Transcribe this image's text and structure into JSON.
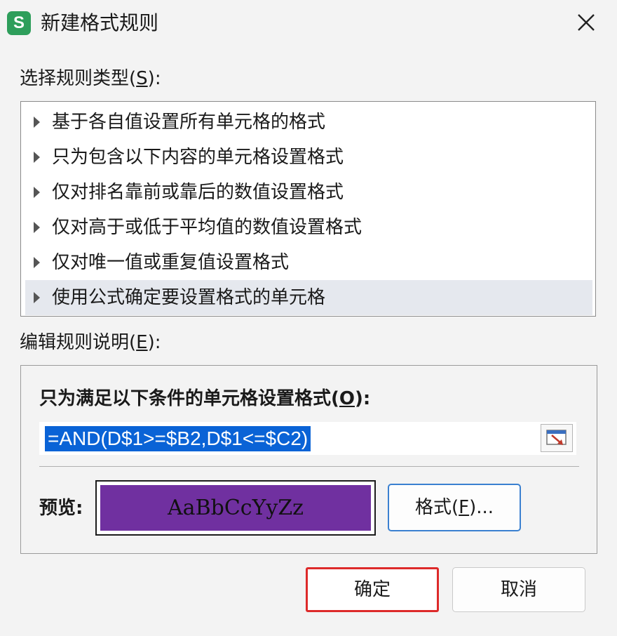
{
  "window": {
    "app_icon_letter": "S",
    "title": "新建格式规则",
    "close_icon": "close-icon"
  },
  "rule_type": {
    "label": "选择规则类型(",
    "mnemonic": "S",
    "label_suffix": "):",
    "items": [
      {
        "label": "基于各自值设置所有单元格的格式",
        "selected": false
      },
      {
        "label": "只为包含以下内容的单元格设置格式",
        "selected": false
      },
      {
        "label": "仅对排名靠前或靠后的数值设置格式",
        "selected": false
      },
      {
        "label": "仅对高于或低于平均值的数值设置格式",
        "selected": false
      },
      {
        "label": "仅对唯一值或重复值设置格式",
        "selected": false
      },
      {
        "label": "使用公式确定要设置格式的单元格",
        "selected": true
      }
    ]
  },
  "edit_rule": {
    "label": "编辑规则说明(",
    "mnemonic": "E",
    "label_suffix": "):",
    "condition_label": "只为满足以下条件的单元格设置格式(",
    "condition_mnemonic": "O",
    "condition_label_suffix": "):",
    "formula": "=AND(D$1>=$B2,D$1<=$C2)",
    "ref_icon": "range-select-icon",
    "preview_label": "预览:",
    "preview_text": "AaBbCcYyZz",
    "preview_fill_color": "#7030a0",
    "format_button": {
      "label": "格式(",
      "mnemonic": "F",
      "suffix": ")..."
    }
  },
  "buttons": {
    "ok": "确定",
    "cancel": "取消",
    "ok_highlight_color": "#dd2a2a"
  }
}
